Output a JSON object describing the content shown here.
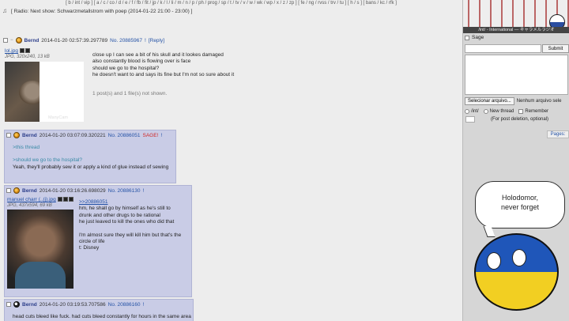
{
  "board_nav": "[ b / int / vip ] [ a / c / co / d / e / f / fb / fit / jp / k / l / li / m / n / p / ph / prog / sp / t / tv / v / w / wk / wp / x / z / zp ] [ fe / ng / rvss / trv / tu ] [ h / s ] [ bans / kc / rfk ]",
  "radio": "[ Radio: Next show: Schwarzmetallstrom with poep (2014-01-22 21:00 - 23:00) ]",
  "op": {
    "hide": "−",
    "name": "Bernd",
    "date": "2014-01-20 02:57:39.297789",
    "number": "No. 20885967",
    "marker": "!",
    "reply": "[Reply]",
    "file_name": "lol.jpg",
    "file_info": "JPG, 320x240, 13 kB",
    "thumb_watermark": "ManyCam",
    "lines": [
      "close up I can see a bit of his skull and it lookes damaged",
      "also constantly blood is flowing over is face",
      "should we go to the hospital?",
      "he doesn't want to and says its fine but I'm not so sure about it"
    ],
    "omitted": "1 post(s) and 1 file(s) not shown."
  },
  "replies": [
    {
      "name": "Bernd",
      "date": "2014-01-20 03:07:09.320221",
      "number": "No. 20886051",
      "sage": "SAGE!",
      "marker": "!",
      "lines": [
        ">this thread",
        "",
        ">should we go to the hospital?",
        "Yeah, they'll probably sew it or apply a kind of glue instead of sewing"
      ]
    },
    {
      "name": "Bernd",
      "date": "2014-01-20 03:16:26.698029",
      "number": "No. 20886130",
      "marker": "!",
      "file_name": "manuel charr (..(j).jpg",
      "file_info": "JPG, 437x594, 69 kB",
      "quote": ">>20886051",
      "lines": [
        "hm, he shall go by himself as he's still to",
        "drunk and other drugs to be rational",
        "he just leaved to kill the ones who did that",
        "",
        "I'm almost sure they will kill him but that's the",
        "circle of life",
        "t: Disney"
      ]
    },
    {
      "name": "Bernd",
      "date": "2014-01-20 03:19:53.707586",
      "number": "No. 20886160",
      "marker": "!",
      "lines": [
        "head cuts bleed like fuck. had cuts bleed constantly for hours in the same area"
      ]
    }
  ],
  "sidebar": {
    "banner_text": "/int/ - International — キャラメルラジオ",
    "sage_label": "Sage",
    "submit_label": "Submit",
    "file_button": "Selecionar arquivo...",
    "no_file": "Nenhum arquivo sele",
    "board_opt": "/int/",
    "new_thread": "New thread",
    "remember": "Remember",
    "pass_note": "(For post deletion, optional)",
    "pages": "Pages:"
  },
  "mascot": {
    "speech": [
      "Holodomor,",
      "never forget"
    ]
  }
}
